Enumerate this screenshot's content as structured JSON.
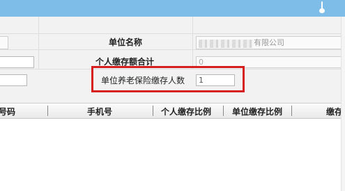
{
  "form": {
    "unit_name_label": "单位名称",
    "unit_name_value": "有限公司",
    "personal_total_label": "个人缴存额合计",
    "personal_total_value": "0",
    "pension_count_label": "单位养老保险缴存人数",
    "pension_count_value": "1"
  },
  "table": {
    "columns": [
      "号码",
      "手机号",
      "个人缴存比例",
      "单位缴存比例",
      "缴存"
    ]
  },
  "colors": {
    "topbar": "#7fbde9",
    "highlight": "#d61e1e"
  }
}
